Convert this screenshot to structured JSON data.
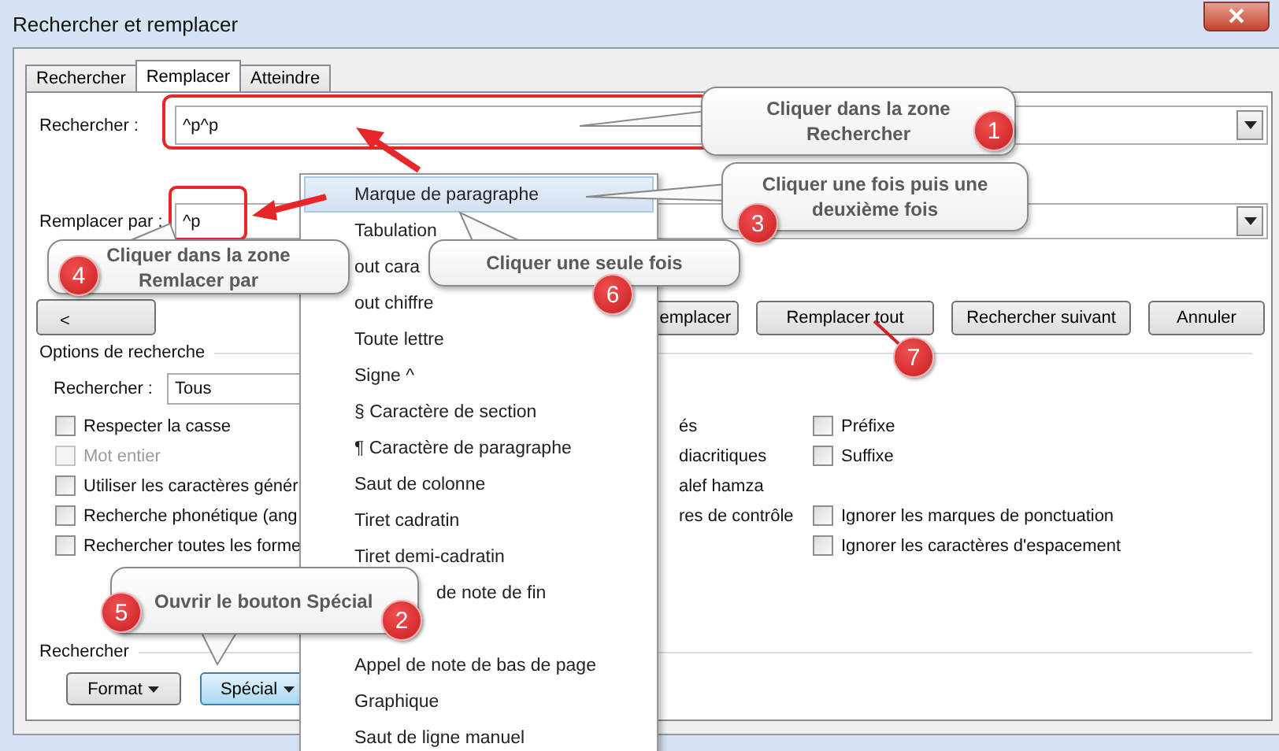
{
  "window": {
    "title": "Rechercher et remplacer"
  },
  "tabs": [
    {
      "label": "Rechercher",
      "selected": false
    },
    {
      "label": "Remplacer",
      "selected": true
    },
    {
      "label": "Atteindre",
      "selected": false
    }
  ],
  "find": {
    "label": "Rechercher :",
    "value": "^p^p"
  },
  "replace": {
    "label": "Remplacer par :",
    "value": "^p"
  },
  "actions": [
    {
      "label": "<"
    },
    {
      "label": "emplacer"
    },
    {
      "label": "Remplacer tout"
    },
    {
      "label": "Rechercher suivant"
    },
    {
      "label": "Annuler"
    }
  ],
  "options": {
    "title": "Options de recherche",
    "search_label": "Rechercher :",
    "search_value": "Tous",
    "rows": [
      {
        "left": {
          "label": "Respecter la casse",
          "checked": false,
          "disabled": false
        },
        "middle": "és",
        "right": {
          "label": "Préfixe",
          "checked": false
        }
      },
      {
        "left": {
          "label": "Mot entier",
          "checked": false,
          "disabled": true
        },
        "middle": "diacritiques",
        "right": {
          "label": "Suffixe",
          "checked": false
        }
      },
      {
        "left": {
          "label": "Utiliser les caractères génér",
          "checked": false,
          "disabled": false
        },
        "middle": "alef hamza"
      },
      {
        "left": {
          "label": "Recherche phonétique (ang",
          "checked": false,
          "disabled": false
        },
        "middle": "res de contrôle",
        "right": {
          "label": "Ignorer les marques de ponctuation",
          "checked": false
        }
      },
      {
        "left": {
          "label": "Rechercher toutes les forme",
          "checked": false,
          "disabled": false
        },
        "right": {
          "label": "Ignorer les caractères d'espacement",
          "checked": false
        }
      }
    ]
  },
  "replace_section": {
    "title": "Rechercher",
    "buttons": [
      {
        "label": "Format",
        "selected": false
      },
      {
        "label": "Spécial",
        "selected": true
      }
    ]
  },
  "special_menu": [
    {
      "kind": "item",
      "label": "Marque de paragraphe",
      "selected": true
    },
    {
      "kind": "item",
      "label": "Tabulation",
      "selected": false
    },
    {
      "kind": "item",
      "label": "out cara",
      "selected": false
    },
    {
      "kind": "item",
      "label": "out chiffre",
      "selected": false
    },
    {
      "kind": "item",
      "label": "Toute lettre",
      "selected": false
    },
    {
      "kind": "item",
      "label": "Signe ^",
      "selected": false
    },
    {
      "kind": "item",
      "label": "§ Caractère de section",
      "selected": false
    },
    {
      "kind": "item",
      "label": "¶ Caractère de paragraphe",
      "selected": false
    },
    {
      "kind": "item",
      "label": "Saut de colonne",
      "selected": false
    },
    {
      "kind": "item",
      "label": "Tiret cadratin",
      "selected": false
    },
    {
      "kind": "item",
      "label": "Tiret demi-cadratin",
      "selected": false
    },
    {
      "kind": "partial",
      "label": "de note de fin",
      "selected": false
    },
    {
      "kind": "hidden"
    },
    {
      "kind": "item",
      "label": "Appel de note de bas de page",
      "selected": false
    },
    {
      "kind": "item",
      "label": "Graphique",
      "selected": false
    },
    {
      "kind": "item",
      "label": "Saut de ligne manuel",
      "selected": false
    }
  ],
  "callouts": [
    {
      "lines": [
        "Cliquer dans la zone",
        "Rechercher"
      ],
      "steps": [
        "1"
      ]
    },
    {
      "lines": [
        "Cliquer une fois puis une",
        "deuxième fois"
      ],
      "steps": [
        "3"
      ]
    },
    {
      "lines": [
        "Cliquer dans la zone",
        "Remlacer par"
      ],
      "steps": [
        "4"
      ]
    },
    {
      "lines": [
        "Cliquer une seule fois"
      ],
      "steps": [
        "6"
      ]
    },
    {
      "lines": [
        "Ouvrir le bouton Spécial"
      ],
      "steps": [
        "5",
        "2"
      ]
    }
  ],
  "step_markers": [
    {
      "step": "7"
    }
  ]
}
